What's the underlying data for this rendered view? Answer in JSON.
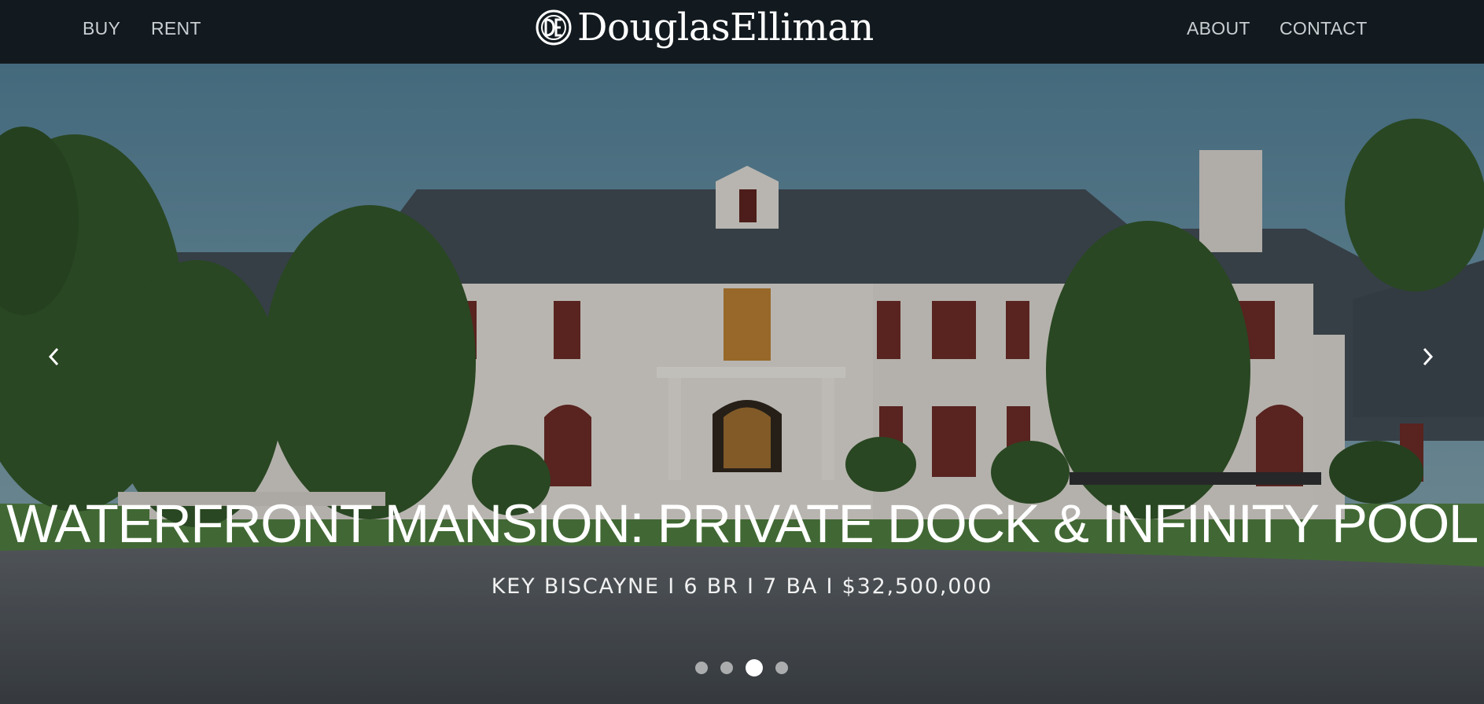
{
  "nav": {
    "left": [
      {
        "label": "BUY"
      },
      {
        "label": "RENT"
      }
    ],
    "right": [
      {
        "label": "ABOUT"
      },
      {
        "label": "CONTACT"
      }
    ],
    "logo_text": "DouglasElliman"
  },
  "hero": {
    "headline": "WATERFRONT MANSION: PRIVATE DOCK & INFINITY POOL",
    "subline": "KEY BISCAYNE I 6 BR I 7 BA I $32,500,000",
    "image_alt": "White French chateau-style mansion with slate roof and circular driveway",
    "slides_count": 4,
    "active_slide": 3,
    "prev_icon": "chevron-left-icon",
    "next_icon": "chevron-right-icon"
  },
  "colors": {
    "header_bg": "#121a1f",
    "nav_text": "#c9ced2",
    "hero_text": "#ffffff"
  }
}
